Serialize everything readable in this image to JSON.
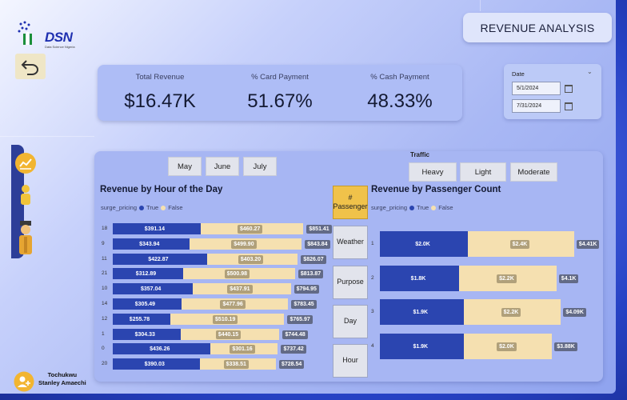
{
  "logo": {
    "text": "DSN",
    "subtitle": "Data Science Nigeria"
  },
  "title": "REVENUE ANALYSIS",
  "kpis": [
    {
      "label": "Total Revenue",
      "value": "$16.47K"
    },
    {
      "label": "% Card Payment",
      "value": "51.67%"
    },
    {
      "label": "% Cash Payment",
      "value": "48.33%"
    }
  ],
  "date_filter": {
    "label": "Date",
    "start": "5/1/2024",
    "end": "7/31/2024"
  },
  "months": [
    "May",
    "June",
    "July"
  ],
  "traffic": {
    "title": "Traffic",
    "options": [
      "Heavy",
      "Light",
      "Moderate"
    ]
  },
  "views": [
    "# Passenger",
    "Weather",
    "Purpose",
    "Day",
    "Hour"
  ],
  "user": {
    "name_line1": "Tochukwu",
    "name_line2": "Stanley Amaechi"
  },
  "colors": {
    "true": "#2b45b0",
    "false": "#f5e0b0",
    "active_view": "#f0c24a"
  },
  "icons": [
    "back-arrow-icon",
    "line-chart-icon",
    "person-yellow-icon",
    "officer-icon",
    "add-user-icon",
    "calendar-icon",
    "chevron-down-icon"
  ],
  "chart_data": [
    {
      "type": "bar",
      "orientation": "horizontal",
      "stacked": true,
      "title": "Revenue by Hour of the Day",
      "legend_title": "surge_pricing",
      "categories": [
        "18",
        "9",
        "11",
        "21",
        "10",
        "14",
        "12",
        "1",
        "0",
        "20"
      ],
      "series": [
        {
          "name": "True",
          "values": [
            391.14,
            343.94,
            422.87,
            312.89,
            357.04,
            305.49,
            255.78,
            304.33,
            436.26,
            390.03
          ],
          "labels": [
            "$391.14",
            "$343.94",
            "$422.87",
            "$312.89",
            "$357.04",
            "$305.49",
            "$255.78",
            "$304.33",
            "$436.26",
            "$390.03"
          ]
        },
        {
          "name": "False",
          "values": [
            460.27,
            499.9,
            403.2,
            500.98,
            437.91,
            477.96,
            510.19,
            440.15,
            301.16,
            338.51
          ],
          "labels": [
            "$460.27",
            "$499.90",
            "$403.20",
            "$500.98",
            "$437.91",
            "$477.96",
            "$510.19",
            "$440.15",
            "$301.16",
            "$338.51"
          ]
        }
      ],
      "totals": [
        "$851.41",
        "$843.84",
        "$826.07",
        "$813.87",
        "$794.95",
        "$783.45",
        "$765.97",
        "$744.48",
        "$737.42",
        "$728.54"
      ]
    },
    {
      "type": "bar",
      "orientation": "horizontal",
      "stacked": true,
      "title": "Revenue by Passenger Count",
      "legend_title": "surge_pricing",
      "categories": [
        "1",
        "2",
        "3",
        "4"
      ],
      "series": [
        {
          "name": "True",
          "values": [
            2000,
            1800,
            1900,
            1900
          ],
          "labels": [
            "$2.0K",
            "$1.8K",
            "$1.9K",
            "$1.9K"
          ]
        },
        {
          "name": "False",
          "values": [
            2400,
            2200,
            2200,
            2000
          ],
          "labels": [
            "$2.4K",
            "$2.2K",
            "$2.2K",
            "$2.0K"
          ]
        }
      ],
      "totals": [
        "$4.41K",
        "$4.1K",
        "$4.09K",
        "$3.88K"
      ]
    }
  ]
}
